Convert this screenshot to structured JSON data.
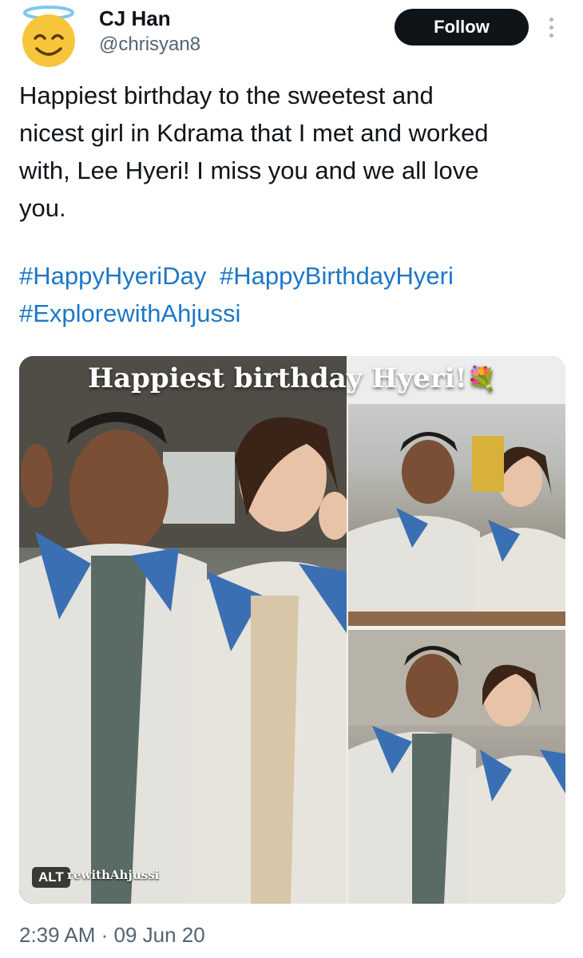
{
  "author": {
    "name": "CJ Han",
    "handle": "@chrisyan8",
    "avatar_icon": "smiling-face-with-halo-icon"
  },
  "actions": {
    "follow_label": "Follow",
    "more_icon": "vertical-ellipsis-icon"
  },
  "tweet": {
    "text": "Happiest birthday to the sweetest and\nnicest girl in Kdrama that I met and worked\nwith, Lee Hyeri! I miss you and we all love\nyou.",
    "hashtags": [
      "#HappyHyeriDay",
      "#HappyBirthdayHyeri",
      "#ExplorewithAhjussi"
    ]
  },
  "media": {
    "overlay_title": "Happiest birthday Hyeri!",
    "flower_emoji": "💐",
    "watermark": "rewithAhjussi",
    "alt_label": "ALT"
  },
  "meta": {
    "timestamp": "2:39 AM · 09 Jun 20"
  },
  "colors": {
    "link": "#1d77c7",
    "button_bg": "#0f1419",
    "secondary_text": "#536471"
  }
}
